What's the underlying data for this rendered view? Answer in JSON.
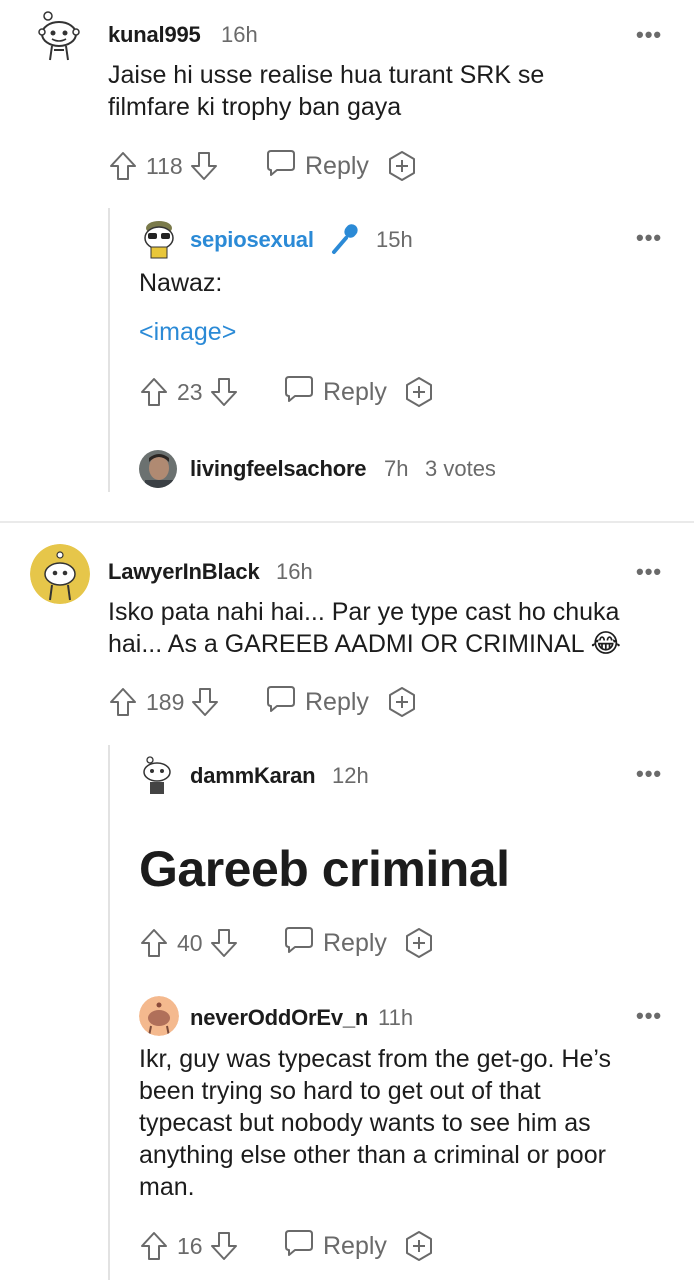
{
  "comments": [
    {
      "id": "c1",
      "username": "kunal995",
      "time": "16h",
      "body": "Jaise hi usse realise hua turant SRK se filmfare ki trophy ban gaya",
      "body_line1": "Jaise hi usse realise hua turant SRK se",
      "body_line2": "filmfare ki trophy ban gaya",
      "votes": "118",
      "reply_label": "Reply"
    },
    {
      "id": "c1r1",
      "username": "sepiosexual",
      "time": "15h",
      "body": "Nawaz:",
      "media_placeholder": "<image>",
      "votes": "23",
      "reply_label": "Reply",
      "username_color": "#2b8ad6"
    },
    {
      "id": "c1r2",
      "username": "livingfeelsachore",
      "time": "7h",
      "votes_text": "3 votes"
    },
    {
      "id": "c2",
      "username": "LawyerInBlack",
      "time": "16h",
      "body_line1": "Isko pata nahi hai... Par ye type cast ho chuka",
      "body_line2": "hai... As a GAREEB AADMI OR CRIMINAL",
      "emoji": "😂",
      "votes": "189",
      "reply_label": "Reply"
    },
    {
      "id": "c2r1",
      "username": "dammKaran",
      "time": "12h",
      "body": "Gareeb criminal",
      "votes": "40",
      "reply_label": "Reply"
    },
    {
      "id": "c2r2",
      "username": "neverOddOrEv_n",
      "time": "11h",
      "body_lines": [
        "Ikr, guy was typecast from the get-go. He’s",
        "been trying so hard to get out of that",
        "typecast but nobody wants to see him as",
        "anything else other than a criminal or poor",
        "man."
      ],
      "votes": "16",
      "reply_label": "Reply"
    }
  ],
  "more_label": "•••",
  "colors": {
    "link": "#2b8ad6",
    "meta": "#6a6a6a",
    "text": "#1c1c1c",
    "thread_line": "#e2e2e2"
  },
  "icons": [
    "upvote-icon",
    "downvote-icon",
    "reply-bubble-icon",
    "award-plus-icon",
    "microphone-icon",
    "more-icon"
  ]
}
